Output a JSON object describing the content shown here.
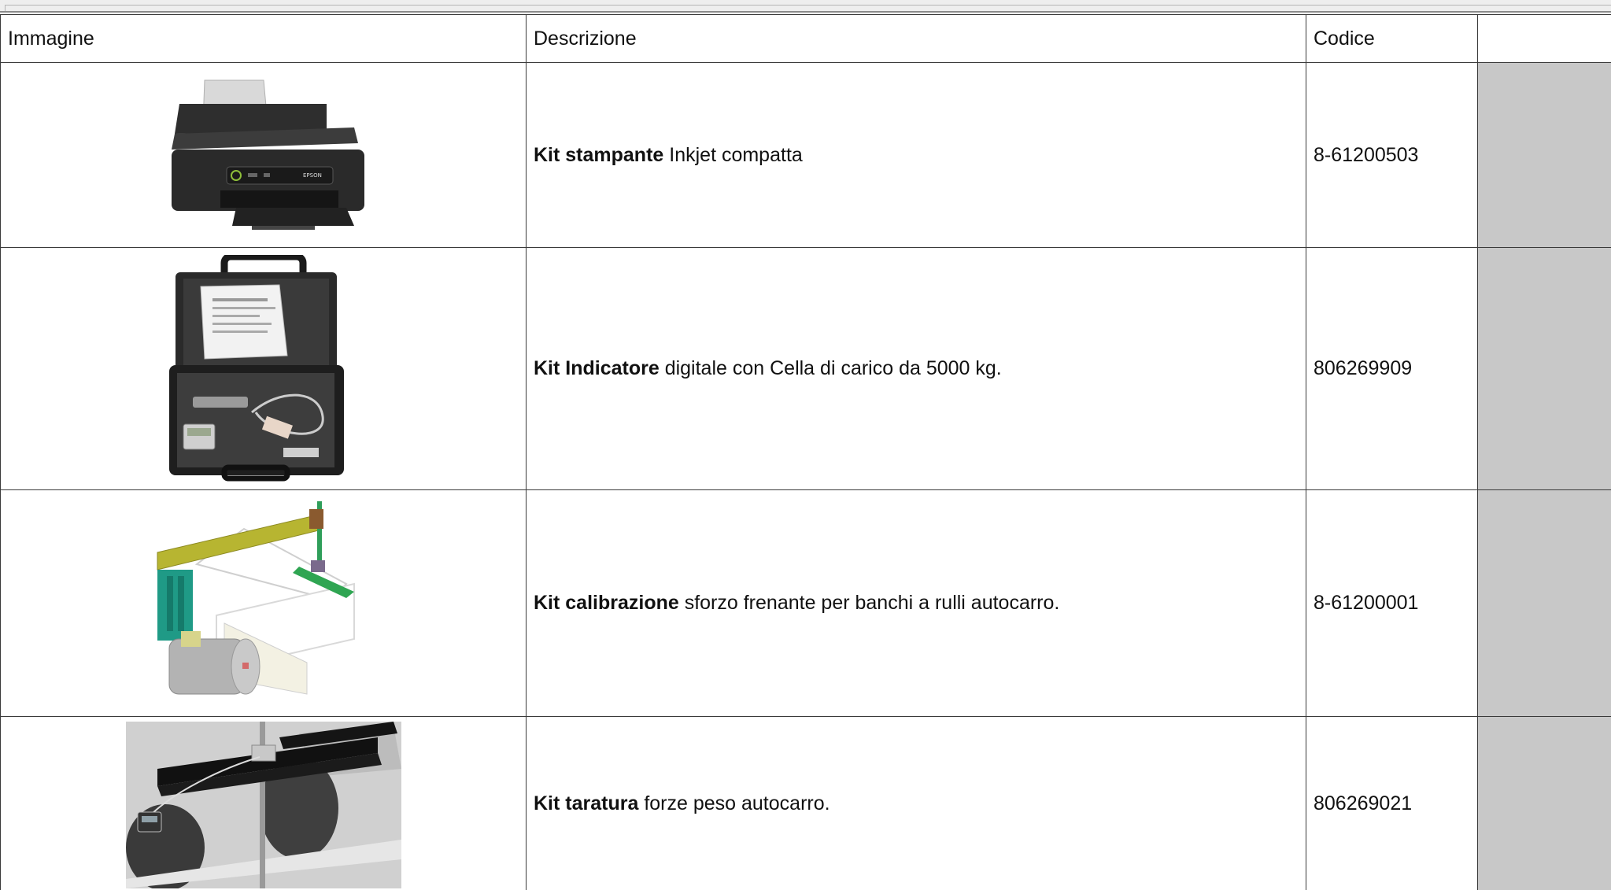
{
  "table": {
    "headers": {
      "image": "Immagine",
      "description": "Descrizione",
      "code": "Codice",
      "action": ""
    },
    "rows": [
      {
        "title": "Kit stampante",
        "rest": " Inkjet compatta",
        "code": "8-61200503",
        "image": "inkjet-printer"
      },
      {
        "title": "Kit Indicatore",
        "rest": " digitale con Cella di carico da 5000 kg.",
        "code": "806269909",
        "image": "load-cell-case"
      },
      {
        "title": "Kit calibrazione",
        "rest": " sforzo frenante per banchi a rulli autocarro.",
        "code": "8-61200001",
        "image": "calibration-kit"
      },
      {
        "title": "Kit taratura",
        "rest": " forze peso autocarro.",
        "code": "806269021",
        "image": "weight-calibration-rig"
      }
    ]
  }
}
